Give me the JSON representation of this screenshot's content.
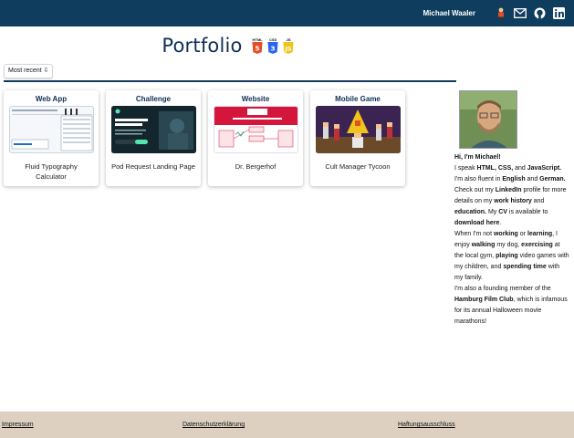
{
  "header": {
    "name": "Michael Waaler",
    "icons": [
      "person-icon",
      "mail-icon",
      "github-icon",
      "linkedin-icon"
    ]
  },
  "page": {
    "title": "Portfolio",
    "badges": [
      "HTML",
      "CSS",
      "JS"
    ],
    "sort_label": "Most recent ⇩"
  },
  "projects": [
    {
      "category": "Web App",
      "title": "Fluid Typography Calculator"
    },
    {
      "category": "Challenge",
      "title": "Pod Request Landing Page"
    },
    {
      "category": "Website",
      "title": "Dr. Bergerhof"
    },
    {
      "category": "Mobile Game",
      "title": "Cult Manager Tycoon"
    }
  ],
  "bio": {
    "greeting": "Hi, I'm Michael!",
    "p1": [
      "I speak ",
      "HTML, CSS,",
      " and ",
      "JavaScript."
    ],
    "p2": [
      "I'm also fluent in ",
      "English",
      " and ",
      "German."
    ],
    "p3": [
      "Check out my ",
      "LinkedIn",
      " profile for more details on my ",
      "work history",
      " and ",
      "education.",
      " My ",
      "CV",
      " is available to ",
      "download here",
      "."
    ],
    "p4": [
      "When I'm not ",
      "working",
      " or ",
      "learning",
      ", I enjoy ",
      "walking",
      " my dog, ",
      "exercising",
      " at the local gym, ",
      "playing",
      " video games with my children, and ",
      "spending time",
      " with my family."
    ],
    "p5": [
      "I'm also a founding member of the ",
      "Hamburg Film Club",
      ", which is infamous for its annual Halloween movie marathons!"
    ]
  },
  "footer": {
    "links": [
      "Impressum",
      "Datenschutzerklärung",
      "Haftungsausschluss"
    ]
  },
  "colors": {
    "navy": "#0f3d5e",
    "title": "#0f2e55",
    "footer": "#ddd0c1",
    "html5": "#e44d26",
    "css3": "#2965f1",
    "js": "#f0c419"
  }
}
